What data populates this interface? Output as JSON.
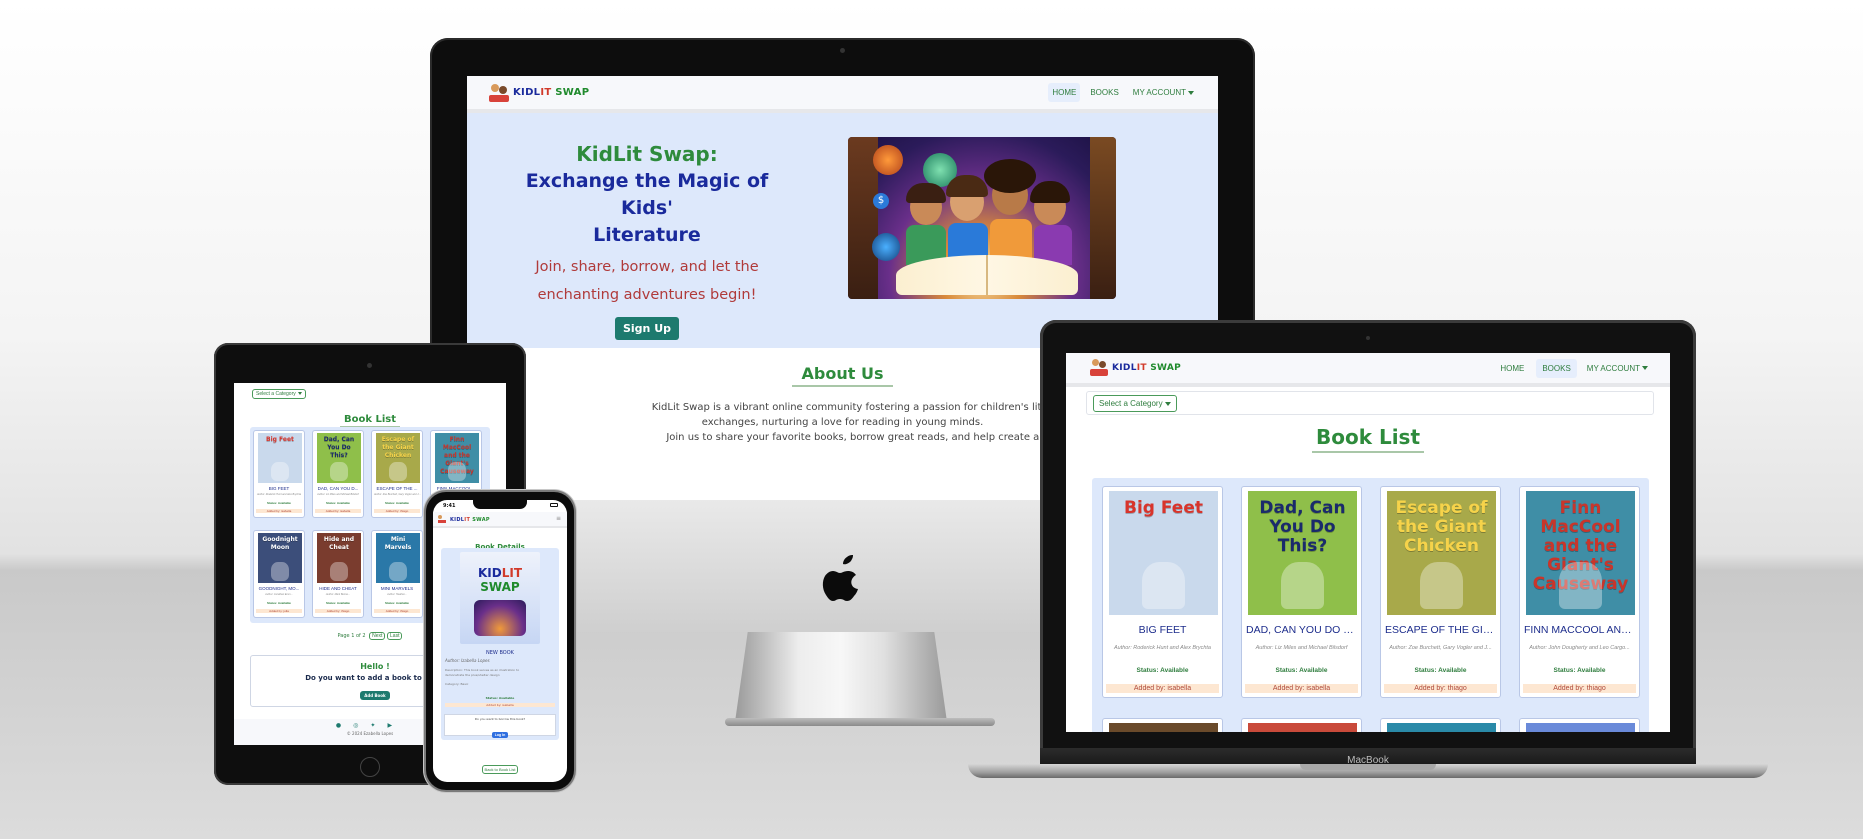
{
  "brand": {
    "part1": "KIDL",
    "part2": "IT",
    "part3": " SWAP"
  },
  "nav": {
    "home": "HOME",
    "books": "BOOKS",
    "account": "MY ACCOUNT"
  },
  "hero": {
    "title_line1": "KidLit Swap:",
    "title_line2": "Exchange the Magic of Kids'",
    "title_line3": "Literature",
    "tagline_line1": "Join, share, borrow, and let the",
    "tagline_line2": "enchanting adventures begin!",
    "signup": "Sign Up"
  },
  "about": {
    "title": "About Us",
    "line1": "KidLit Swap is a vibrant online community fostering a passion for children's literature. Our virtual library",
    "line2": "exchanges, nurturing a love for reading in young minds.",
    "line3": "Join us to share your favorite books, borrow great reads, and help create a future generation of pa"
  },
  "booklist": {
    "category_button": "Select a Category",
    "title": "Book List"
  },
  "books": [
    {
      "title": "BIG FEET",
      "title_short": "BIG FEET",
      "author": "Author: Roderick Hunt and Alex Brychta",
      "status": "Status: Available",
      "added": "Added by: isabella",
      "cover_title": "Big Feet",
      "cover_bg": "#c9d9ec",
      "cover_text": "#d8342b"
    },
    {
      "title": "DAD, CAN YOU DO TH...",
      "title_short": "DAD, CAN YOU D...",
      "author": "Author: Liz Miles and Michael Bilsdorf",
      "status": "Status: Available",
      "added": "Added by: isabella",
      "cover_title": "Dad, Can You Do This?",
      "cover_bg": "#8fbf4a",
      "cover_text": "#1a2a6c"
    },
    {
      "title": "ESCAPE OF THE GIAN...",
      "title_short": "ESCAPE OF THE ...",
      "author": "Author: Zoe Burchett, Gary Vogler and J...",
      "status": "Status: Available",
      "added": "Added by: thiago",
      "cover_title": "Escape of the Giant Chicken",
      "cover_bg": "#a8a94a",
      "cover_text": "#f6d34a"
    },
    {
      "title": "FINN MACCOOL AND ...",
      "title_short": "FINN MACCOOL...",
      "author": "Author: John Dougherty and Leo Cargo...",
      "status": "Status: Available",
      "added": "Added by: thiago",
      "cover_title": "Finn MacCool and the Giant's Causeway",
      "cover_bg": "#3f8ea6",
      "cover_text": "#c9352b"
    }
  ],
  "tablet_books_row2": [
    {
      "title": "GOODNIGHT, MO...",
      "author": "Author: Jonathan Emm...",
      "status": "Status: Available",
      "added": "Added by: julia",
      "cover_title": "Goodnight Moon",
      "cover_bg": "#3c4e7a"
    },
    {
      "title": "HIDE AND CHEAT",
      "author": "Author: Mark Benne...",
      "status": "Status: Available",
      "added": "Added by: thiago",
      "cover_title": "Hide and Cheat",
      "cover_bg": "#7a3c2e"
    },
    {
      "title": "MINI MARVELS",
      "author": "Author: Heather...",
      "status": "Status: Available",
      "added": "Added by: thiago",
      "cover_title": "Mini Marvels",
      "cover_bg": "#2a78a8"
    }
  ],
  "tablet": {
    "pagination": "Page 1 of 2",
    "next": "Next",
    "last": "Last",
    "hello": "Hello !",
    "prompt": "Do you want to add a book to our li",
    "add_book": "Add Book",
    "footer": "© 2024 Ezabella Lopes"
  },
  "phone": {
    "time": "9:41",
    "details_title": "Book Details",
    "book_title": "NEW BOOK",
    "author": "Author: Izabella Lopes",
    "description": "Description: This book serves as an illustration to demonstrate the plus/shelter design",
    "category": "Category: Basic",
    "status": "Status: Available",
    "added": "Added by: isabella",
    "borrow_prompt": "Do you want to borrow this book?",
    "login": "Log In",
    "back": "Back to Book List"
  },
  "laptop_brand": "MacBook",
  "colors": {
    "brand_green": "#2e8b3c",
    "navy": "#1d2d8c",
    "hero_bg": "#dde8fb",
    "button_teal": "#1d7a6e",
    "tagline_red": "#b03a3a"
  },
  "icons": [
    "facebook-icon",
    "instagram-icon",
    "twitter-icon",
    "youtube-icon",
    "apple-logo-icon"
  ]
}
